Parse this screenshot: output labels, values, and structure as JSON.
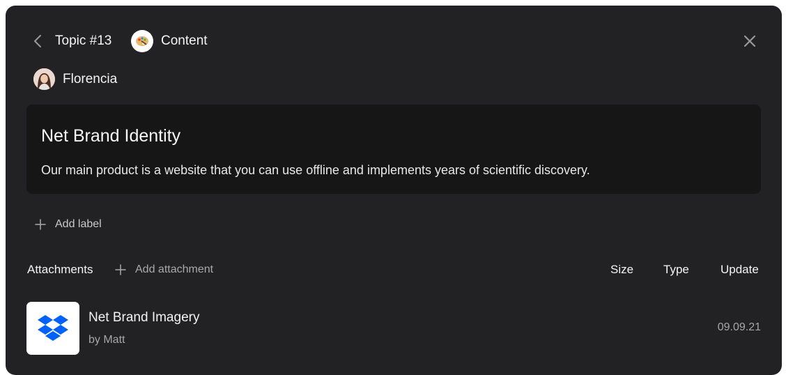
{
  "header": {
    "topic": "Topic #13",
    "category": "Content",
    "back_icon": "chevron-left-icon",
    "close_icon": "close-icon",
    "category_icon": "palette-icon"
  },
  "assignee": {
    "name": "Florencia"
  },
  "card": {
    "title": "Net Brand Identity",
    "description": "Our main product is a website that you can use offline and implements years of scientific discovery."
  },
  "labels": {
    "add_label": "Add label"
  },
  "attachments": {
    "title": "Attachments",
    "add_attachment": "Add attachment",
    "columns": [
      "Size",
      "Type",
      "Update"
    ],
    "files": [
      {
        "name": "Net Brand Imagery",
        "author": "by Matt",
        "date": "09.09.21",
        "icon": "dropbox-icon"
      }
    ]
  },
  "colors": {
    "panel_bg": "#222224",
    "card_bg": "#161617",
    "dropbox_blue": "#0061fe"
  }
}
